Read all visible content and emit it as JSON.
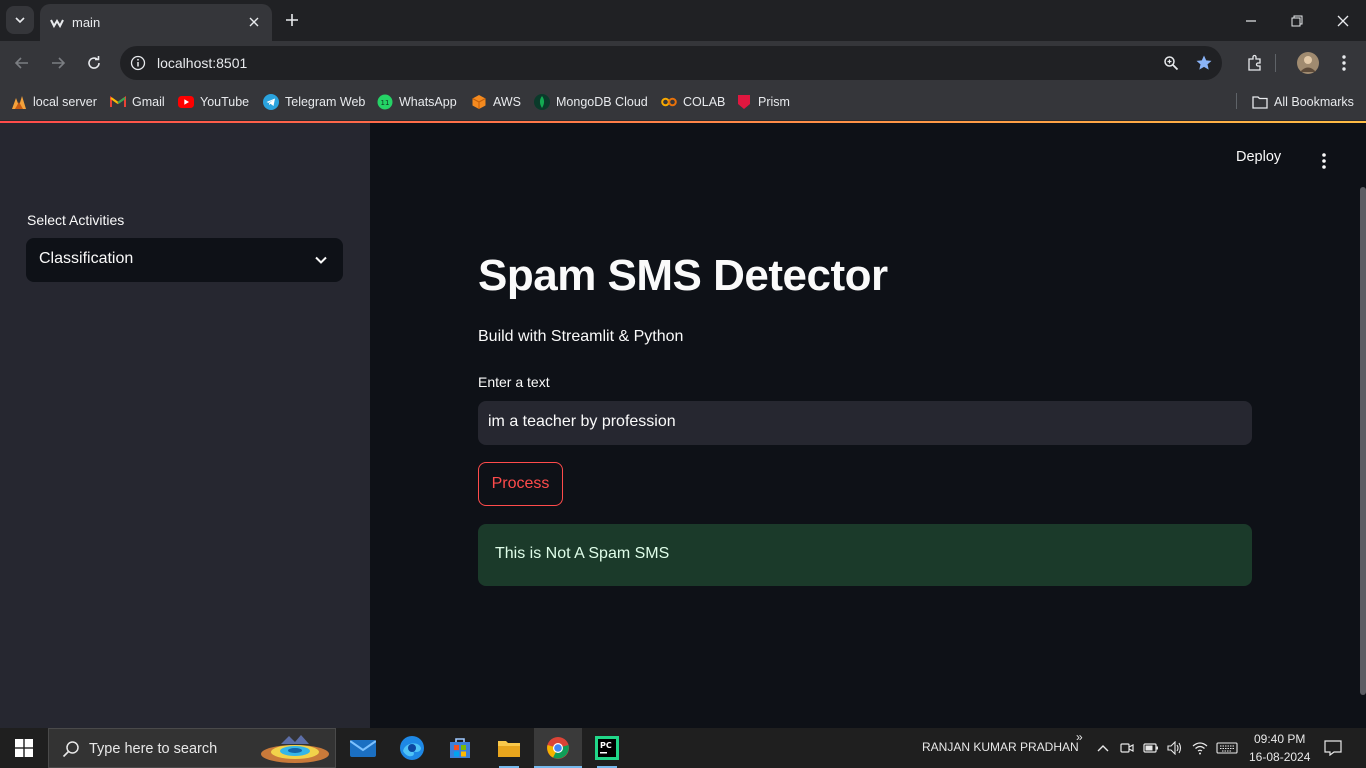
{
  "browser": {
    "tab_title": "main",
    "url": "localhost:8501",
    "bookmarks": [
      {
        "label": "local server",
        "icon": "local-server-icon"
      },
      {
        "label": "Gmail",
        "icon": "gmail-icon"
      },
      {
        "label": "YouTube",
        "icon": "youtube-icon"
      },
      {
        "label": "Telegram Web",
        "icon": "telegram-icon"
      },
      {
        "label": "WhatsApp",
        "icon": "whatsapp-icon"
      },
      {
        "label": "AWS",
        "icon": "aws-icon"
      },
      {
        "label": "MongoDB Cloud",
        "icon": "mongodb-icon"
      },
      {
        "label": "COLAB",
        "icon": "colab-icon"
      },
      {
        "label": "Prism",
        "icon": "prism-icon"
      }
    ],
    "all_bookmarks": "All Bookmarks"
  },
  "sidebar": {
    "label": "Select Activities",
    "selected": "Classification"
  },
  "header": {
    "deploy": "Deploy"
  },
  "main": {
    "title": "Spam SMS Detector",
    "subtitle": "Build with Streamlit & Python",
    "input_label": "Enter a text",
    "input_value": "im a teacher by profession",
    "button": "Process",
    "result": "This is Not A Spam SMS"
  },
  "taskbar": {
    "search_placeholder": "Type here to search",
    "user": "RANJAN KUMAR PRADHAN",
    "time": "09:40 PM",
    "date": "16-08-2024"
  },
  "colors": {
    "accent": "#ff4b4b",
    "success_bg": "#1b3a2a",
    "sidebar_bg": "#262730",
    "main_bg": "#0e1117"
  }
}
